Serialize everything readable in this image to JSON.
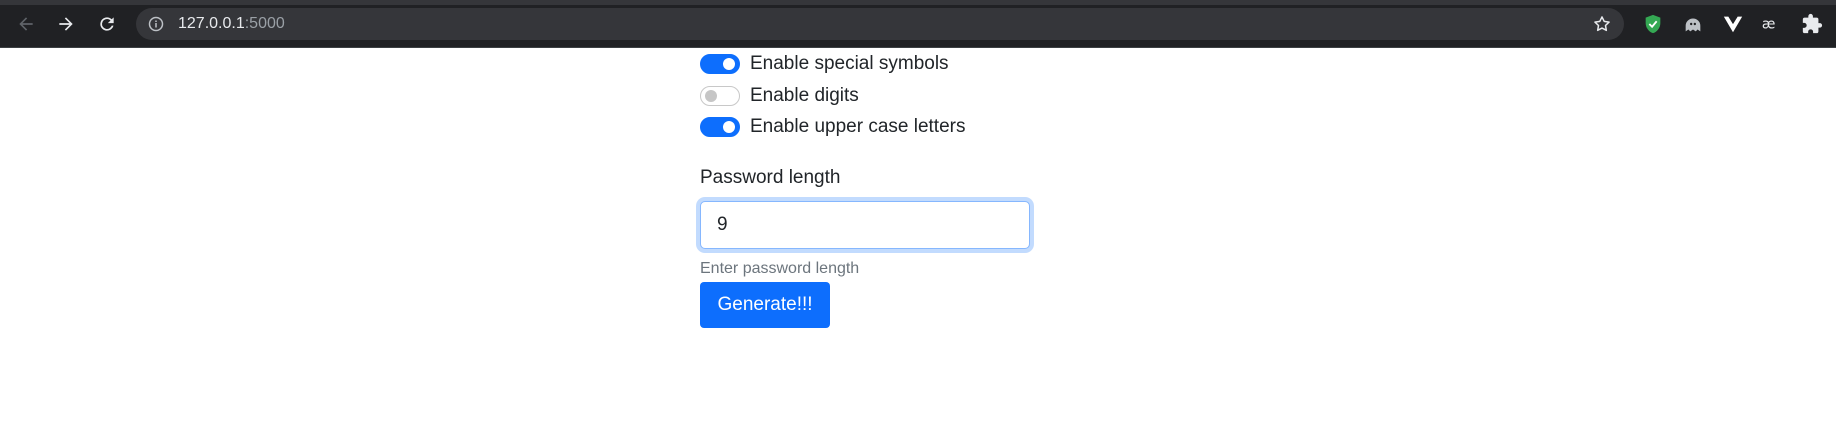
{
  "browser": {
    "url_host": "127.0.0.1",
    "url_port": ":5000",
    "nav": {
      "back_icon": "arrow-left-icon",
      "forward_icon": "arrow-right-icon",
      "reload_icon": "reload-icon"
    },
    "extensions": [
      {
        "name": "shield-extension-icon",
        "color": "#34a853"
      },
      {
        "name": "ghost-extension-icon",
        "color": "#bdc1c6"
      },
      {
        "name": "vue-devtools-icon",
        "color": "#ffffff"
      },
      {
        "name": "ae-ligature-extension-icon",
        "color": "#e8eaed"
      },
      {
        "name": "puzzle-extensions-icon",
        "color": "#e8eaed"
      }
    ]
  },
  "form": {
    "switches": [
      {
        "label": "Enable special symbols",
        "checked": true
      },
      {
        "label": "Enable digits",
        "checked": false
      },
      {
        "label": "Enable upper case letters",
        "checked": true
      }
    ],
    "length_label": "Password length",
    "length_value": "9",
    "length_help": "Enter password length",
    "submit_label": "Generate!!!"
  },
  "colors": {
    "primary": "#0d6efd",
    "chrome_bg": "#202124",
    "omnibox_bg": "#35363a",
    "help_text": "#6c757d"
  }
}
